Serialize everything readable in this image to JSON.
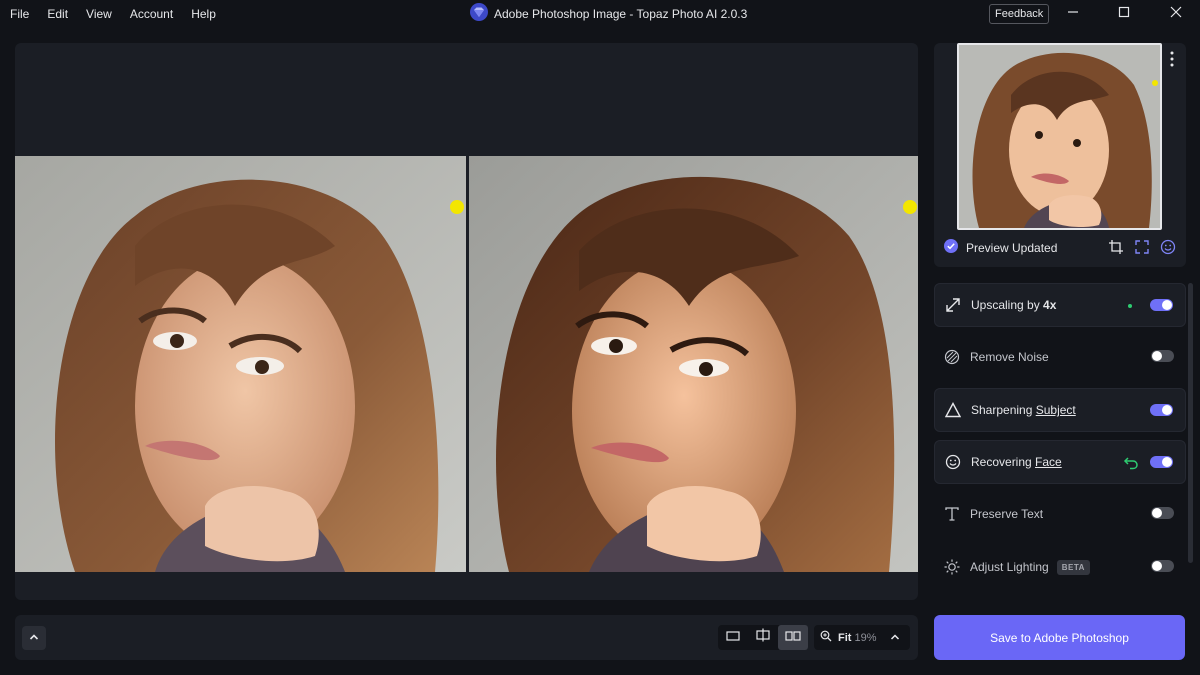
{
  "menu": {
    "items": [
      "File",
      "Edit",
      "View",
      "Account",
      "Help"
    ]
  },
  "window": {
    "title": "Adobe Photoshop Image - Topaz Photo AI 2.0.3",
    "feedback_label": "Feedback"
  },
  "preview": {
    "status_label": "Preview Updated"
  },
  "features": [
    {
      "label_pre": "Upscaling by ",
      "label_bold": "4x",
      "enabled": true,
      "icon": "upscale-icon"
    },
    {
      "label_pre": "Remove Noise",
      "enabled": false,
      "icon": "remove-noise-icon"
    },
    {
      "label_pre": "Sharpening ",
      "label_link": "Subject",
      "enabled": true,
      "icon": "sharpen-icon"
    },
    {
      "label_pre": "Recovering ",
      "label_link": "Face",
      "enabled": true,
      "icon": "face-icon"
    },
    {
      "label_pre": "Preserve Text",
      "enabled": false,
      "icon": "text-icon"
    },
    {
      "label_pre": "Adjust Lighting",
      "badge": "BETA",
      "enabled": false,
      "icon": "lighting-icon"
    }
  ],
  "bottom_bar": {
    "zoom_label": "Fit",
    "zoom_value": "19%"
  },
  "save_button_label": "Save to Adobe Photoshop",
  "colors": {
    "accent": "#6a67f6",
    "toggle_on": "#6f70f7",
    "background": "#111318",
    "panel": "#1b1e25",
    "cursor_marker": "#f3e600"
  }
}
